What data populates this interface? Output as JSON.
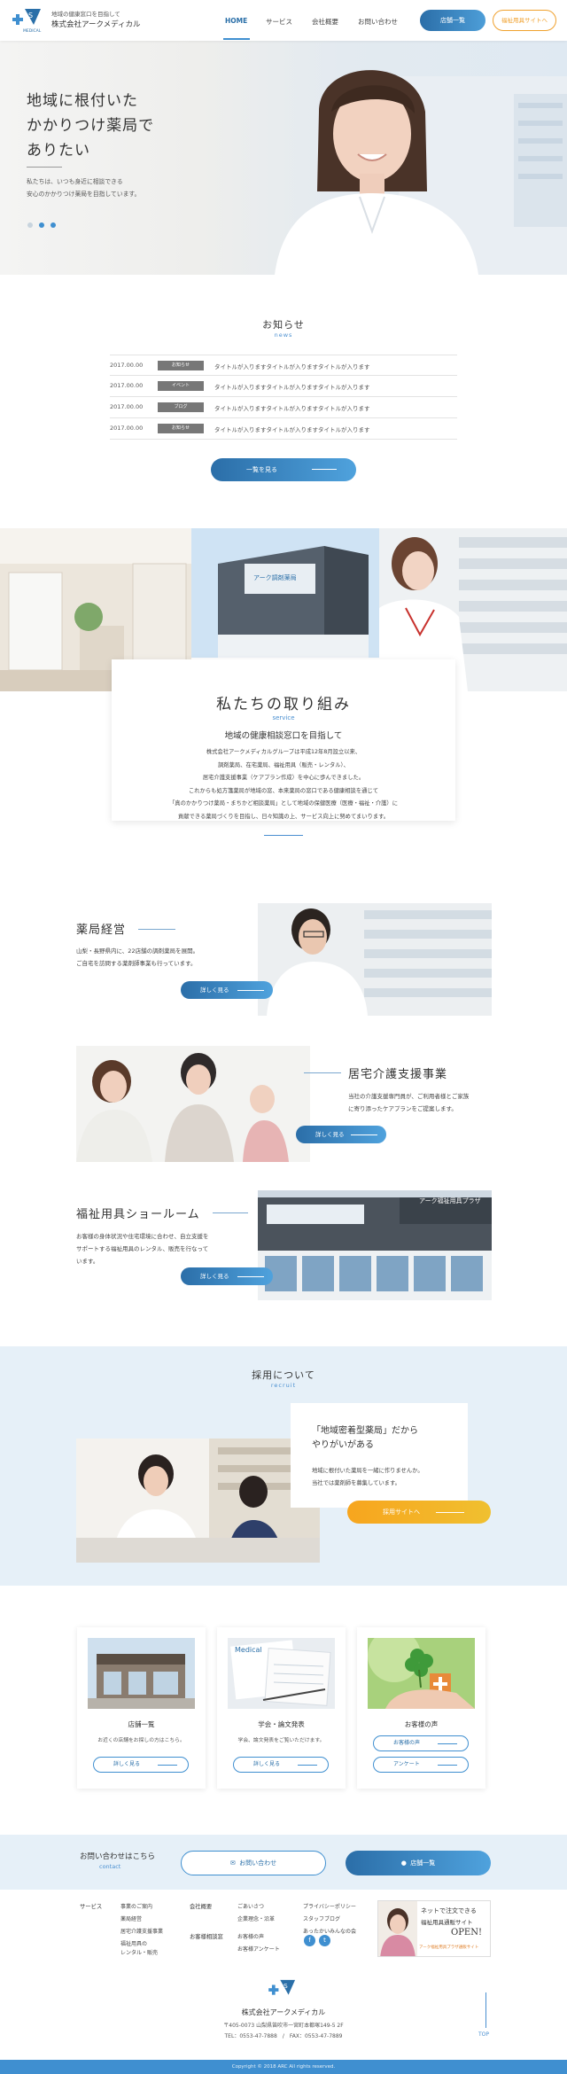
{
  "header": {
    "tagline": "地域の健康窓口を目指して",
    "company": "株式会社アークメディカル",
    "nav": [
      "HOME",
      "サービス",
      "会社概要",
      "お問い合わせ"
    ],
    "stores_button": "店舗一覧",
    "welfare_button": "福祉用具サイトへ"
  },
  "hero": {
    "heading_lines": [
      "地域に根付いた",
      "かかりつけ薬局で",
      "ありたい"
    ],
    "text_lines": [
      "私たちは、いつも身近に相談できる",
      "安心のかかりつけ薬局を目指しています。"
    ],
    "slide_count": 3,
    "active_slide": 2
  },
  "news": {
    "title": "お知らせ",
    "subtitle": "news",
    "items": [
      {
        "date": "2017.00.00",
        "category": "お知らせ",
        "text": "タイトルが入りますタイトルが入りますタイトルが入ります"
      },
      {
        "date": "2017.00.00",
        "category": "イベント",
        "text": "タイトルが入りますタイトルが入りますタイトルが入ります"
      },
      {
        "date": "2017.00.00",
        "category": "ブログ",
        "text": "タイトルが入りますタイトルが入りますタイトルが入ります"
      },
      {
        "date": "2017.00.00",
        "category": "お知らせ",
        "text": "タイトルが入りますタイトルが入りますタイトルが入ります"
      }
    ],
    "button": "一覧を見る"
  },
  "service_intro": {
    "title": "私たちの取り組み",
    "subtitle": "service",
    "heading": "地域の健康相談窓口を目指して",
    "lines": [
      "株式会社アークメディカルグループは平成12年8月設立以来、",
      "調剤薬局、在宅薬局、福祉用具（販売・レンタル）、",
      "居宅介護支援事業（ケアプラン作成）を中心に歩んできました。",
      "これからも処方箋薬局が地域の窓、本来薬局の窓口である健康相談を通じて",
      "「真のかかりつけ薬局・まちかど相談薬局」として地域の保健医療（医療・福祉・介護）に",
      "貢献できる薬局づくりを目指し、日々知識の上、サービス向上に努めてまいります。"
    ]
  },
  "services": [
    {
      "title": "薬局経営",
      "lines": [
        "山梨・長野県内に、22店舗の調剤薬局を展開。",
        "ご自宅を訪問する薬剤師事業も行っています。"
      ],
      "button": "詳しく見る"
    },
    {
      "title": "居宅介護支援事業",
      "lines": [
        "当社の介護支援専門員が、ご利用者様とご家族",
        "に寄り添ったケアプランをご提案します。"
      ],
      "button": "詳しく見る"
    },
    {
      "title": "福祉用具ショールーム",
      "lines": [
        "お客様の身体状況や住宅環境に合わせ、自立支援を",
        "サポートする福祉用具のレンタル、販売を行なって",
        "います。"
      ],
      "button": "詳しく見る"
    }
  ],
  "showroom_sign": "アーク福祉用具プラザ",
  "recruit": {
    "title": "採用について",
    "subtitle": "recruit",
    "heading_lines": [
      "「地域密着型薬局」だから",
      "やりがいがある"
    ],
    "text_lines": [
      "地域に根付いた薬局を一緒に作りませんか。",
      "当社では薬剤師を募集しています。"
    ],
    "button": "採用サイトへ"
  },
  "boxes": [
    {
      "title": "店舗一覧",
      "text": "お近くの店舗をお探しの方はこちら。",
      "buttons": [
        "詳しく見る"
      ]
    },
    {
      "title": "学会・論文発表",
      "text": "学会、論文発表をご覧いただけます。",
      "buttons": [
        "詳しく見る"
      ]
    },
    {
      "title": "お客様の声",
      "text": "",
      "buttons": [
        "お客様の声",
        "アンケート"
      ]
    }
  ],
  "contact": {
    "heading": "お問い合わせはこちら",
    "subtitle": "contact",
    "contact_button": "お問い合わせ",
    "stores_button": "店舗一覧"
  },
  "footer": {
    "services_head": "サービス",
    "services_links": [
      "事業のご案内",
      "薬局経営",
      "居宅介護支援事業",
      "福祉用具の",
      "レンタル・販売"
    ],
    "company_head": "会社概要",
    "company_links": [
      "ごあいさつ",
      "企業理念・沿革",
      "お客様の声",
      "お客様アンケート"
    ],
    "news_head": "お客様相談窓",
    "other_links": [
      "プライバシーポリシー",
      "スタッフブログ",
      "あったかいみんなの会"
    ],
    "banner_lines": [
      "ネットで注文できる",
      "福祉用具通販サイト",
      "OPEN!",
      "アーク福祉用具プラザ通販サイト"
    ],
    "company": "株式会社アークメディカル",
    "address": "〒405-0073 山梨県笛吹市一宮町本都塚149-5 2F",
    "tel": "TEL：0553-47-7888　/　FAX：0553-47-7889",
    "top_link": "TOP",
    "copyright": "Copyright © 2018 ARC All rights reserved."
  },
  "colors": {
    "accent": "#3f8fd0",
    "accent_dark": "#2a6fa8",
    "orange": "#f0a12e",
    "bg_light": "#e6f0f8"
  }
}
